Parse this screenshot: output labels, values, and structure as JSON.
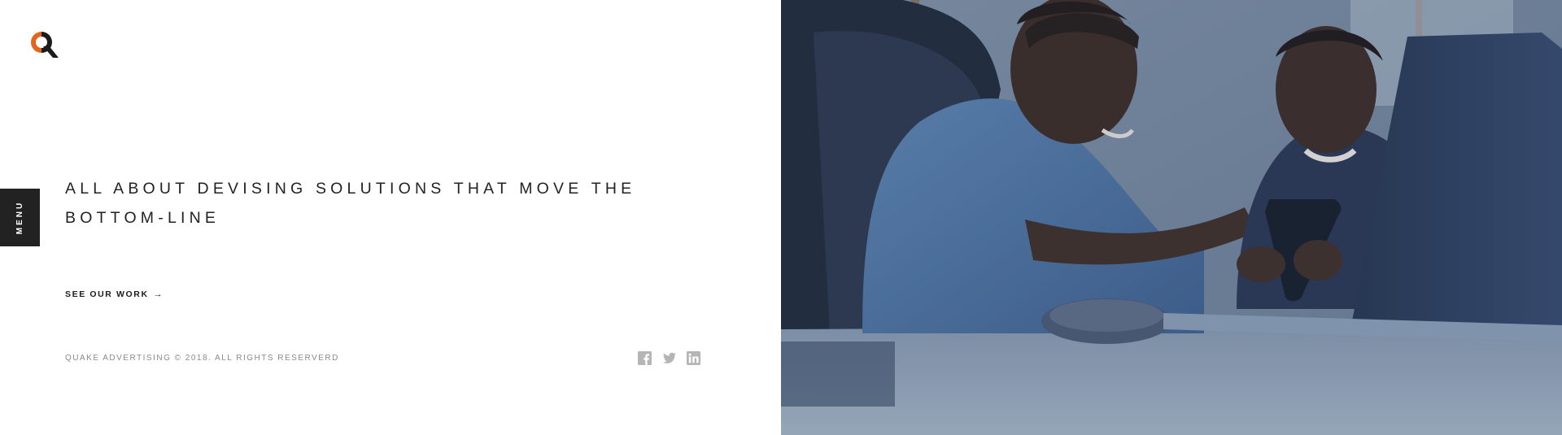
{
  "brand": {
    "logo_letter": "Q",
    "accent_color": "#e3651d"
  },
  "menu": {
    "label": "MENU"
  },
  "hero": {
    "headline": "ALL ABOUT DEVISING SOLUTIONS THAT MOVE THE BOTTOM-LINE",
    "cta_label": "SEE OUR WORK",
    "cta_arrow": "→"
  },
  "footer": {
    "copyright": "QUAKE ADVERTISING © 2018. ALL RIGHTS RESERVERD"
  },
  "social": {
    "icons": [
      "facebook-icon",
      "twitter-icon",
      "linkedin-icon"
    ],
    "color": "#b5b5b5"
  },
  "photo": {
    "tint": "#3c5579",
    "subject": "two men looking at a smartphone at a laptop"
  }
}
